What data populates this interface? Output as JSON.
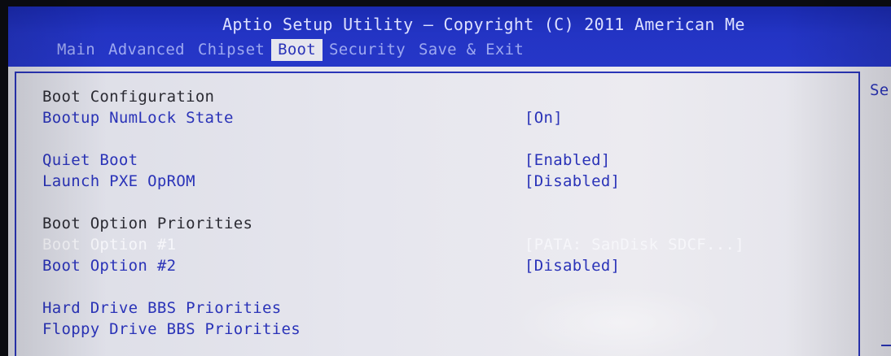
{
  "header": {
    "title": "Aptio Setup Utility – Copyright (C) 2011 American Me"
  },
  "tabs": [
    {
      "label": "Main",
      "active": false
    },
    {
      "label": "Advanced",
      "active": false
    },
    {
      "label": "Chipset",
      "active": false
    },
    {
      "label": "Boot",
      "active": true
    },
    {
      "label": "Security",
      "active": false
    },
    {
      "label": "Save & Exit",
      "active": false
    }
  ],
  "help_panel": {
    "text": "Se"
  },
  "settings": {
    "boot_configuration": {
      "label": "Boot Configuration"
    },
    "bootup_numlock": {
      "label": "Bootup NumLock State",
      "value": "[On]"
    },
    "quiet_boot": {
      "label": "Quiet Boot",
      "value": "[Enabled]"
    },
    "launch_pxe": {
      "label": "Launch PXE OpROM",
      "value": "[Disabled]"
    },
    "boot_option_priorities": {
      "label": "Boot Option Priorities"
    },
    "boot_option_1": {
      "label": "Boot Option #1",
      "value": "[PATA: SanDisk SDCF...]",
      "selected": true
    },
    "boot_option_2": {
      "label": "Boot Option #2",
      "value": "[Disabled]"
    },
    "hdd_bbs": {
      "label": "Hard Drive BBS Priorities"
    },
    "floppy_bbs": {
      "label": "Floppy Drive BBS Priorities"
    }
  },
  "colors": {
    "header_blue": "#2334c4",
    "text_blue": "#2a33b8",
    "background": "#e6e6ee",
    "highlight_text": "#f6f6fa"
  }
}
